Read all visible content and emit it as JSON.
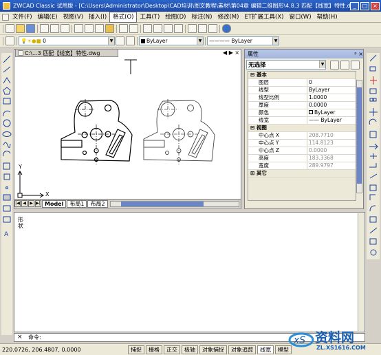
{
  "window": {
    "title": "ZWCAD Classic 试用版 - [C:\\Users\\Administrator\\Desktop\\CAD培训\\图文教程\\素材\\第04章 编辑二维图形\\4.8.3 匹配【线宽】特性.dwg]"
  },
  "menu": [
    {
      "label": "文件(F)"
    },
    {
      "label": "编辑(E)"
    },
    {
      "label": "视图(V)"
    },
    {
      "label": "插入(I)"
    },
    {
      "label": "格式(O)",
      "selected": true
    },
    {
      "label": "工具(T)"
    },
    {
      "label": "绘图(D)"
    },
    {
      "label": "标注(N)"
    },
    {
      "label": "修改(M)"
    },
    {
      "label": "ET扩展工具(X)"
    },
    {
      "label": "窗口(W)"
    },
    {
      "label": "帮助(H)"
    }
  ],
  "toolbar": {
    "layer_value": "0",
    "color_value": "ByLayer",
    "linetype_value": "———— ByLayer"
  },
  "document": {
    "tab_label": "C:\\...3 匹配【线宽】特性.dwg"
  },
  "layouts": [
    {
      "label": "Model",
      "active": true
    },
    {
      "label": "布局1"
    },
    {
      "label": "布局2"
    }
  ],
  "properties": {
    "title": "属性",
    "selection": "无选择",
    "sections": [
      {
        "label": "基本",
        "rows": [
          {
            "key": "图层",
            "value": "0"
          },
          {
            "key": "线型",
            "value": "ByLayer"
          },
          {
            "key": "线型比例",
            "value": "1.0000"
          },
          {
            "key": "厚度",
            "value": "0.0000"
          },
          {
            "key": "颜色",
            "value": "ByLayer"
          },
          {
            "key": "线宽",
            "value": "—— ByLayer"
          }
        ]
      },
      {
        "label": "视图",
        "rows": [
          {
            "key": "中心点 X",
            "value": "208.7710"
          },
          {
            "key": "中心点 Y",
            "value": "114.8123"
          },
          {
            "key": "中心点 Z",
            "value": "0.0000"
          },
          {
            "key": "高度",
            "value": "183.3368"
          },
          {
            "key": "宽度",
            "value": "289.9797"
          }
        ]
      },
      {
        "label": "其它",
        "rows": []
      }
    ]
  },
  "axes": {
    "x": "X",
    "y": "Y"
  },
  "command": {
    "side_label": "形状",
    "prompt": "命令:"
  },
  "status": {
    "coords": "220.0726, 206.4807, 0.0000",
    "buttons": [
      {
        "label": "捕捉"
      },
      {
        "label": "栅格"
      },
      {
        "label": "正交"
      },
      {
        "label": "极轴"
      },
      {
        "label": "对象捕捉"
      },
      {
        "label": "对象追踪"
      },
      {
        "label": "线宽",
        "on": true
      },
      {
        "label": "模型"
      }
    ]
  },
  "watermark": {
    "text": "资料网",
    "url": "ZL.XS1616.COM"
  }
}
